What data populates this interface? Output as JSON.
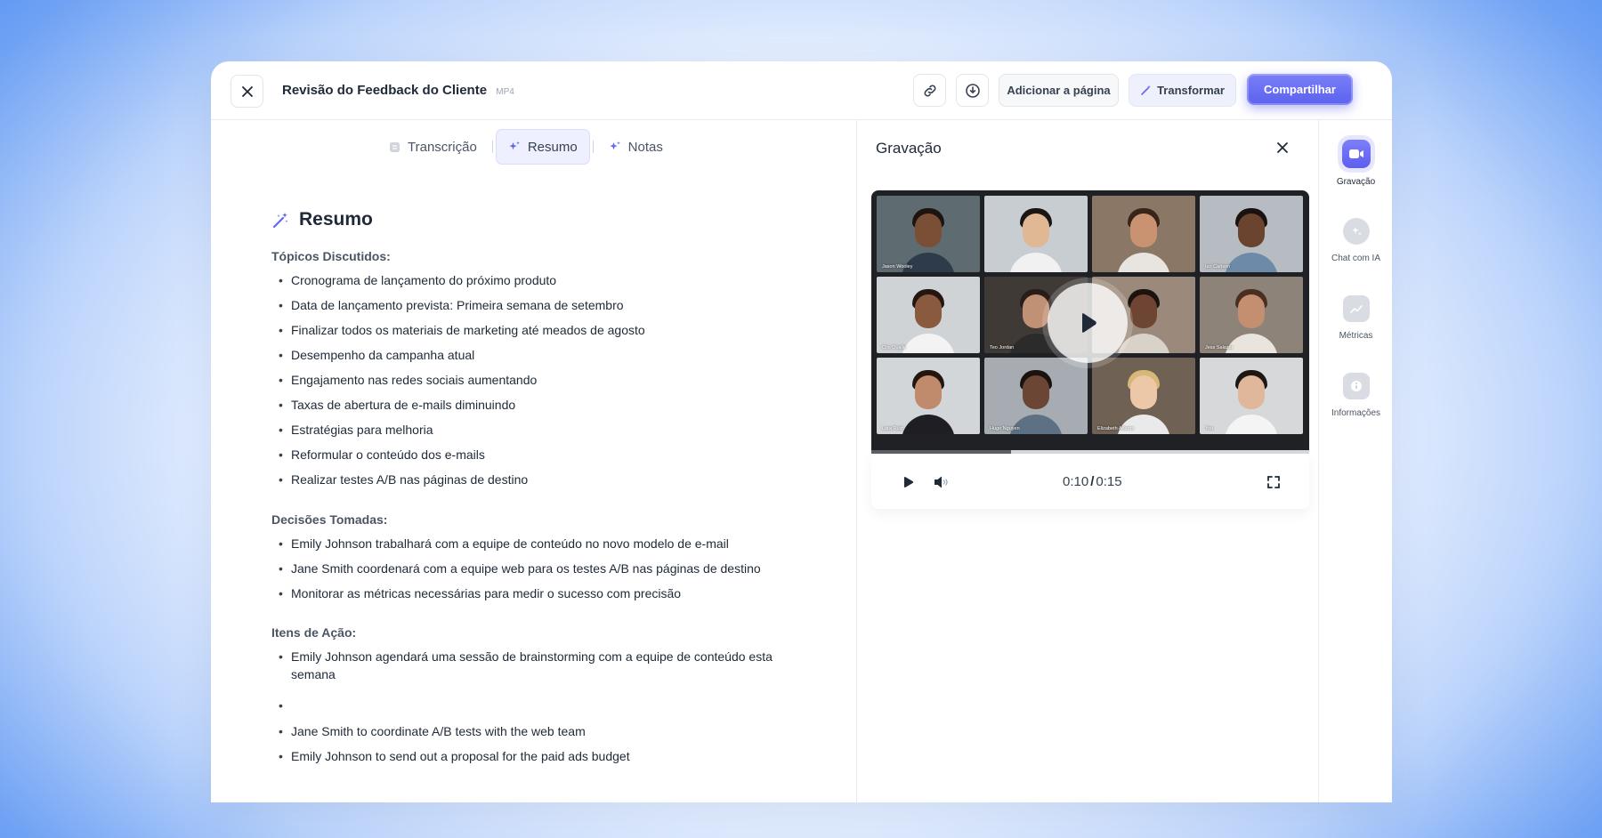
{
  "header": {
    "title": "Revisão do Feedback do Cliente",
    "file_type": "MP4",
    "add_to_page_label": "Adicionar a página",
    "transform_label": "Transformar",
    "share_label": "Compartilhar"
  },
  "tabs": [
    {
      "label": "Transcrição",
      "icon": "document-icon",
      "active": false
    },
    {
      "label": "Resumo",
      "icon": "sparkle-icon",
      "active": true
    },
    {
      "label": "Notas",
      "icon": "sparkle-icon",
      "active": false
    }
  ],
  "summary": {
    "title": "Resumo",
    "topics_heading": "Tópicos Discutidos:",
    "topics": [
      "Cronograma de lançamento do próximo produto",
      "Data de lançamento prevista: Primeira semana de setembro",
      "Finalizar todos os materiais de marketing até meados de agosto",
      "Desempenho da campanha atual",
      "Engajamento nas redes sociais aumentando",
      "Taxas de abertura de e-mails diminuindo",
      "Estratégias para melhoria",
      "Reformular o conteúdo dos e-mails",
      "Realizar testes A/B nas páginas de destino"
    ],
    "decisions_heading": "Decisões Tomadas:",
    "decisions": [
      "Emily Johnson trabalhará com a equipe de conteúdo no novo modelo de e-mail",
      "Jane Smith coordenará com a equipe web para os testes A/B nas páginas de destino",
      "Monitorar as métricas necessárias para medir o sucesso com precisão"
    ],
    "actions_heading": "Itens de Ação:",
    "actions": [
      "Emily Johnson agendará uma sessão de brainstorming com a equipe de conteúdo esta semana",
      "",
      "Jane Smith to coordinate A/B tests with the web team",
      "Emily Johnson to send out a proposal for the paid ads budget"
    ]
  },
  "recording": {
    "title": "Gravação",
    "current_time": "0:10",
    "separator": "/",
    "total_time": "0:15",
    "progress": 0.32,
    "participants": [
      {
        "name": "Jason Wooley",
        "bg": "#5e6b70",
        "skin": "#7a4f36",
        "hair": "#1d1410",
        "shirt": "#2d3b4a"
      },
      {
        "name": "",
        "bg": "#c8cdd2",
        "skin": "#e1b894",
        "hair": "#1b1613",
        "shirt": "#f1f1f1"
      },
      {
        "name": "",
        "bg": "#8a7766",
        "skin": "#c99372",
        "hair": "#3a2419",
        "shirt": "#e8e5e0"
      },
      {
        "name": "Ian Carlson",
        "bg": "#b6bcc2",
        "skin": "#6b4430",
        "hair": "#1a1210",
        "shirt": "#6d8aa8"
      },
      {
        "name": "Cris Ovalle",
        "bg": "#cfd3d6",
        "skin": "#8a5a3f",
        "hair": "#241711",
        "shirt": "#f3f3f3"
      },
      {
        "name": "Teo Jordan",
        "bg": "#3f3a36",
        "skin": "#c19176",
        "hair": "#2a1d17",
        "shirt": "#2b2b2b"
      },
      {
        "name": "",
        "bg": "#9b8a7b",
        "skin": "#6e4532",
        "hair": "#1c120e",
        "shirt": "#d9d2c8"
      },
      {
        "name": "Jess Salazar",
        "bg": "#8e8378",
        "skin": "#c48e70",
        "hair": "#4a2e20",
        "shirt": "#e9e4de"
      },
      {
        "name": "Lara Ruiz",
        "bg": "#d3d6d8",
        "skin": "#c08a6c",
        "hair": "#22160f",
        "shirt": "#1e1e24"
      },
      {
        "name": "Hugo Nguyen",
        "bg": "#a6acb2",
        "skin": "#6b4634",
        "hair": "#1b120e",
        "shirt": "#5e7184"
      },
      {
        "name": "Elizabeth Adams",
        "bg": "#6f6153",
        "skin": "#ecc7a8",
        "hair": "#d8b878",
        "shirt": "#eaeaea"
      },
      {
        "name": "You",
        "bg": "#d6d8da",
        "skin": "#e0b79a",
        "hair": "#1d1713",
        "shirt": "#f4f4f4"
      }
    ]
  },
  "sidebar": [
    {
      "label": "Gravação",
      "icon": "video-camera-icon",
      "active": true
    },
    {
      "label": "Chat com IA",
      "icon": "ai-chat-icon",
      "active": false
    },
    {
      "label": "Métricas",
      "icon": "chart-icon",
      "active": false
    },
    {
      "label": "Informações",
      "icon": "info-icon",
      "active": false
    }
  ],
  "colors": {
    "accent": "#5b62ee",
    "accent_light": "#eef0ff"
  }
}
